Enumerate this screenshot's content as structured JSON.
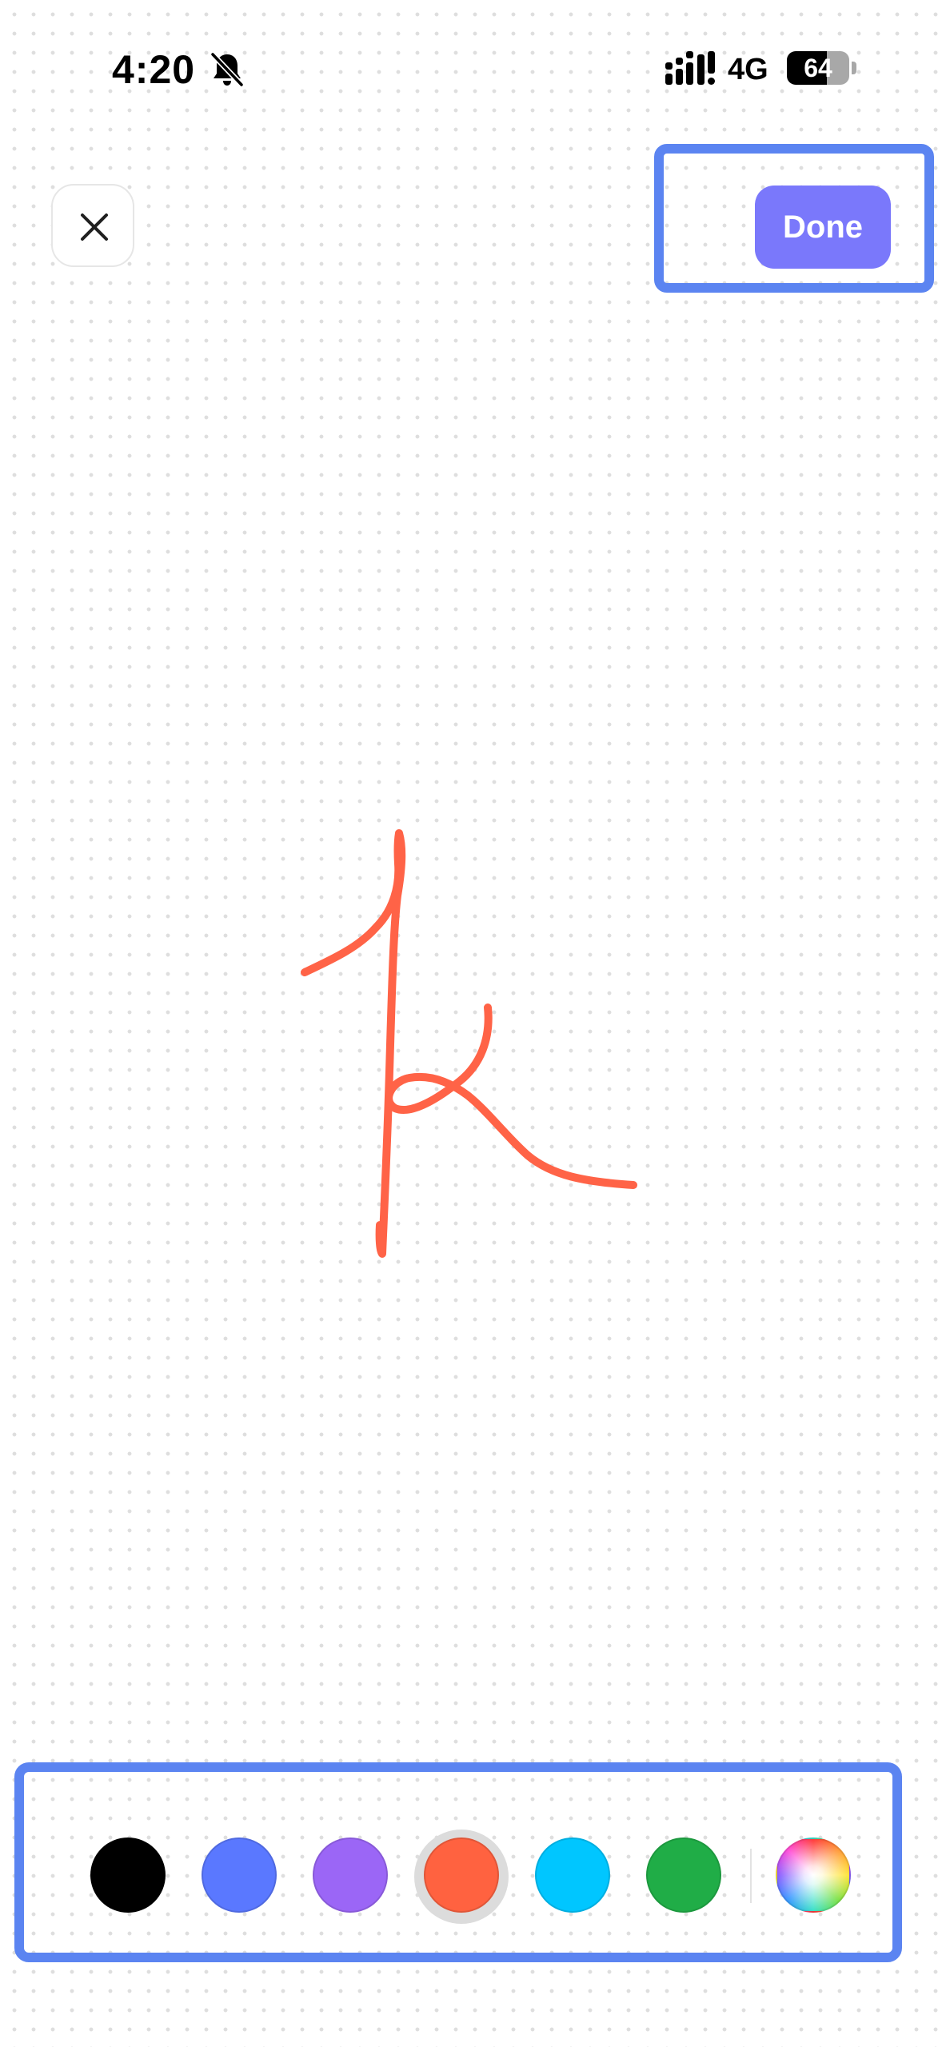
{
  "status_bar": {
    "time": "4:20",
    "silent_icon": "bell-slash-icon",
    "signal_icon": "cellular-signal-icon",
    "network": "4G",
    "battery_level": "64"
  },
  "header": {
    "close_icon": "close-icon",
    "done_label": "Done"
  },
  "drawing": {
    "stroke_color": "#ff6347",
    "description_letter_strokes": 3
  },
  "color_palette": {
    "colors": [
      {
        "name": "black",
        "hex": "#000000"
      },
      {
        "name": "blue",
        "hex": "#5a78ff"
      },
      {
        "name": "purple",
        "hex": "#9b66f6"
      },
      {
        "name": "orange-red",
        "hex": "#ff6240"
      },
      {
        "name": "cyan",
        "hex": "#00c6ff"
      },
      {
        "name": "green",
        "hex": "#20ad47"
      }
    ],
    "selected": "orange-red",
    "custom_color_icon": "color-wheel-icon"
  },
  "colors": {
    "accent": "#7a78fb",
    "highlight_outline": "#5b84f1"
  }
}
